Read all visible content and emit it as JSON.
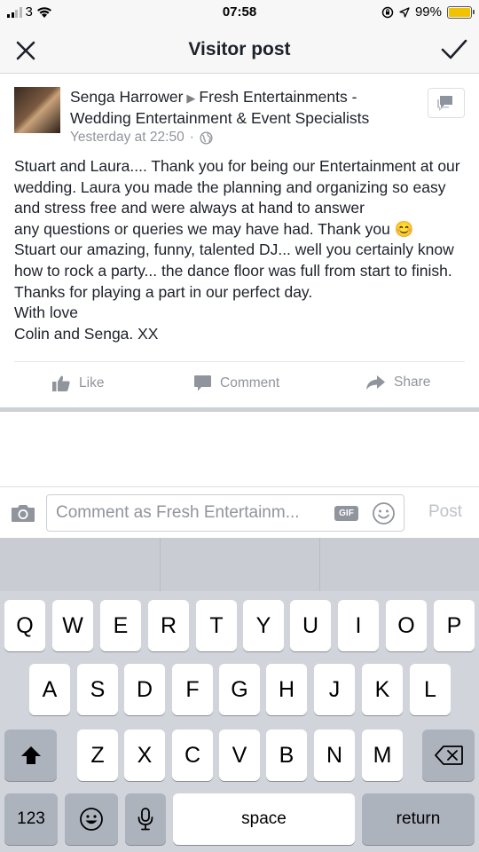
{
  "status_bar": {
    "carrier": "3",
    "time": "07:58",
    "battery": "99%"
  },
  "nav": {
    "title": "Visitor post",
    "close_icon": "close-icon",
    "done_icon": "checkmark-icon"
  },
  "post": {
    "author": "Senga Harrower",
    "arrow": "▶",
    "page": "Fresh Entertainments - Wedding Entertainment & Event Specialists",
    "timestamp": "Yesterday at 22:50",
    "separator": "·",
    "body": "Stuart and Laura.... Thank you for being our Entertainment at our wedding. Laura you made the planning and organizing so easy and stress free and were always at hand to answer\nany questions or queries we may have had. Thank you 😊\nStuart our amazing, funny, talented  DJ... well you certainly know how to rock a party... the dance floor was full from start to finish. Thanks for playing a part in our perfect day.\nWith love\nColin and Senga. XX",
    "actions": {
      "like": "Like",
      "comment": "Comment",
      "share": "Share"
    }
  },
  "comment_bar": {
    "placeholder": "Comment as Fresh Entertainm...",
    "gif": "GIF",
    "post_label": "Post"
  },
  "keyboard": {
    "row1": [
      "Q",
      "W",
      "E",
      "R",
      "T",
      "Y",
      "U",
      "I",
      "O",
      "P"
    ],
    "row2": [
      "A",
      "S",
      "D",
      "F",
      "G",
      "H",
      "J",
      "K",
      "L"
    ],
    "row3": [
      "Z",
      "X",
      "C",
      "V",
      "B",
      "N",
      "M"
    ],
    "numbers_label": "123",
    "space_label": "space",
    "return_label": "return"
  },
  "colors": {
    "accent": "#4267b2",
    "muted": "#90949c",
    "battery": "#f2c200"
  }
}
